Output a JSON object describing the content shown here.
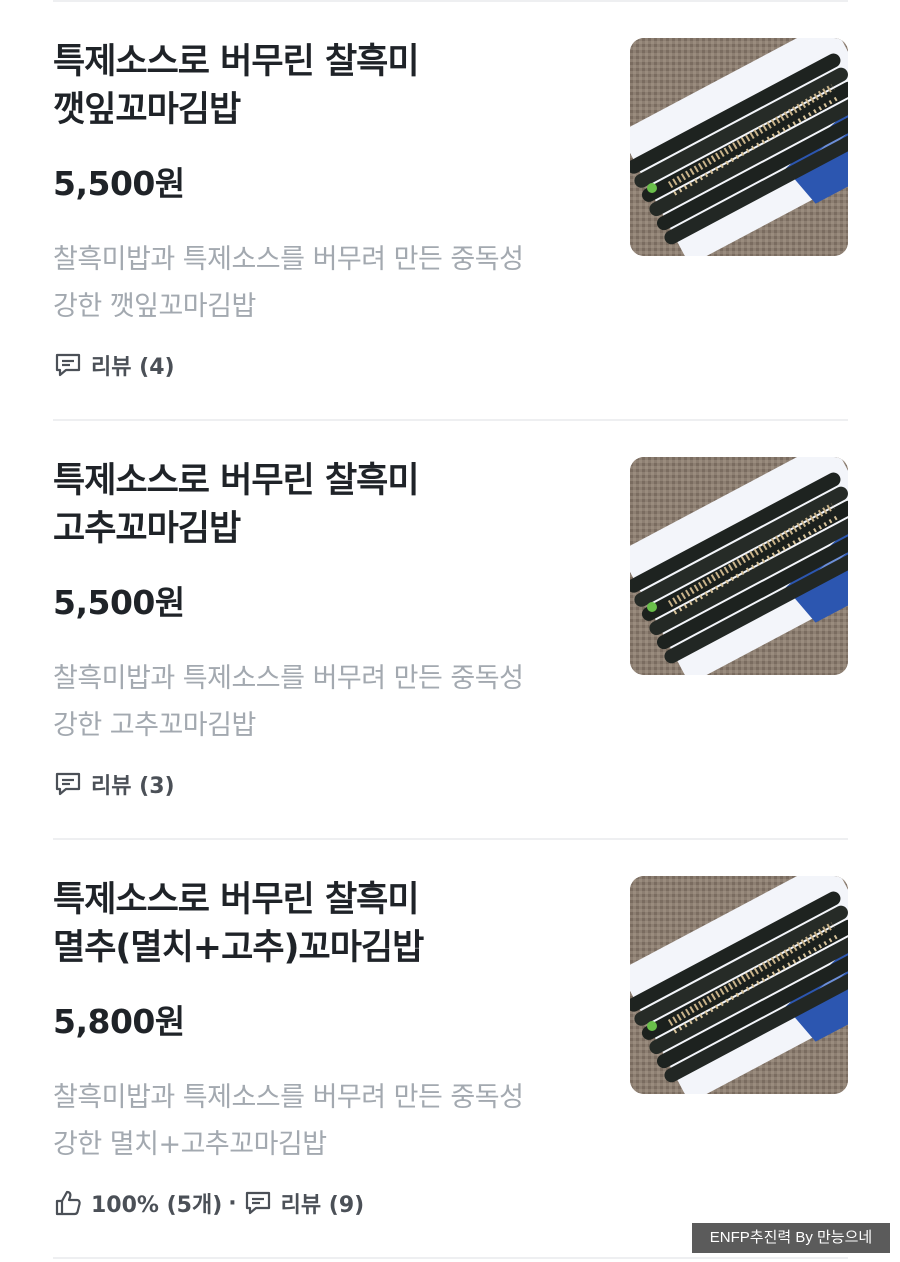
{
  "items": [
    {
      "title_line1": "특제소스로 버무린 찰흑미",
      "title_line2": "깻잎꼬마김밥",
      "price": "5,500원",
      "desc_line1": "찰흑미밥과 특제소스를 버무려 만든 중독성",
      "desc_line2": "강한 깻잎꼬마김밥",
      "review_label": "리뷰 (4)",
      "review_icon": "comment-icon"
    },
    {
      "title_line1": "특제소스로 버무린 찰흑미",
      "title_line2": "고추꼬마김밥",
      "price": "5,500원",
      "desc_line1": "찰흑미밥과 특제소스를 버무려 만든 중독성",
      "desc_line2": "강한 고추꼬마김밥",
      "review_label": "리뷰 (3)",
      "review_icon": "comment-icon"
    },
    {
      "title_line1": "특제소스로 버무린 찰흑미",
      "title_line2": "멸추(멸치+고추)꼬마김밥",
      "price": "5,800원",
      "desc_line1": "찰흑미밥과 특제소스를 버무려 만든 중독성",
      "desc_line2": "강한 멸치+고추꼬마김밥",
      "like_label": "100% (5개)",
      "like_icon": "thumbs-up-icon",
      "separator": "·",
      "review_label": "리뷰 (9)",
      "review_icon": "comment-icon"
    }
  ],
  "watermark": "ENFP추진력 By 만능으네",
  "colors": {
    "title": "#1f2328",
    "description": "#a3a9b0",
    "meta": "#4b5057",
    "divider": "#eeeff1"
  }
}
